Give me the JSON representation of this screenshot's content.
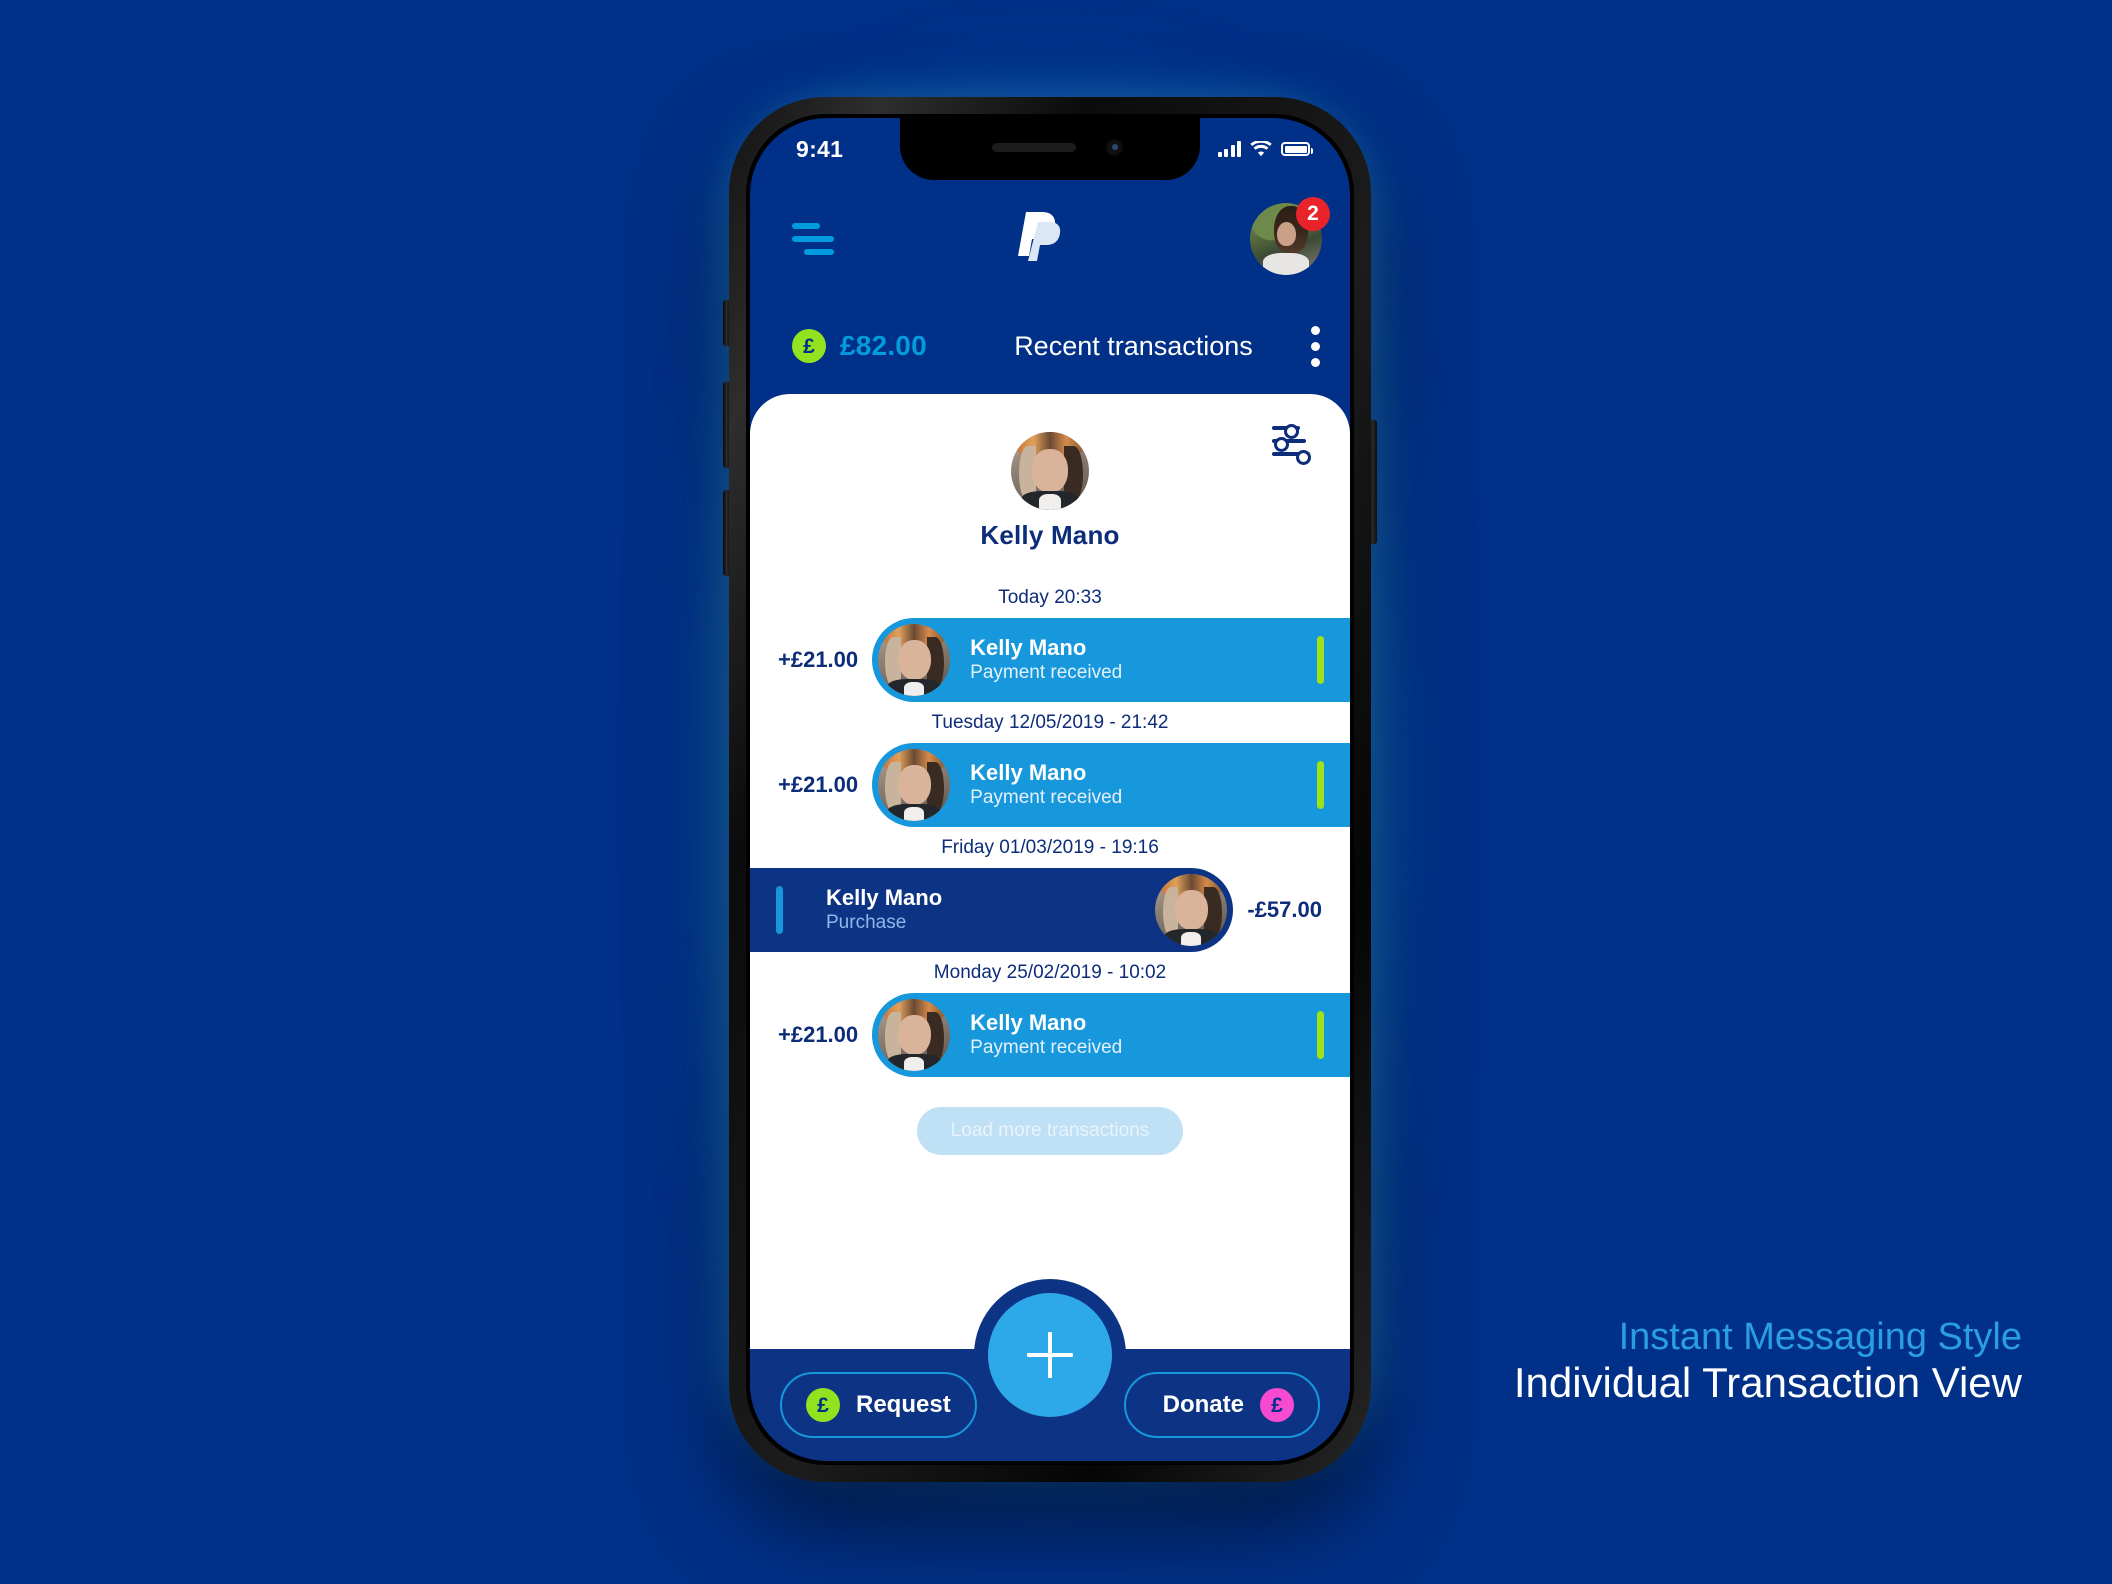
{
  "status_bar": {
    "time": "9:41",
    "signal_icon": "cellular-signal-icon",
    "wifi_icon": "wifi-icon",
    "battery_icon": "battery-icon"
  },
  "header": {
    "menu_icon": "hamburger-menu-icon",
    "logo": "paypal-logo",
    "avatar": "user-avatar",
    "notification_count": "2"
  },
  "balance_strip": {
    "currency_symbol": "£",
    "balance": "£82.00",
    "title": "Recent transactions",
    "overflow_icon": "kebab-menu-icon"
  },
  "card": {
    "filter_icon": "filter-sliders-icon",
    "contact_name": "Kelly Mano",
    "contact_avatar": "contact-avatar",
    "transactions": [
      {
        "date": "Today 20:33",
        "direction": "incoming",
        "amount": "+£21.00",
        "name": "Kelly Mano",
        "subtitle": "Payment received"
      },
      {
        "date": "Tuesday 12/05/2019 - 21:42",
        "direction": "incoming",
        "amount": "+£21.00",
        "name": "Kelly Mano",
        "subtitle": "Payment received"
      },
      {
        "date": "Friday 01/03/2019 - 19:16",
        "direction": "outgoing",
        "amount": "-£57.00",
        "name": "Kelly Mano",
        "subtitle": "Purchase"
      },
      {
        "date": "Monday 25/02/2019 - 10:02",
        "direction": "incoming",
        "amount": "+£21.00",
        "name": "Kelly Mano",
        "subtitle": "Payment received"
      }
    ],
    "load_more_label": "Load more transactions"
  },
  "bottom_bar": {
    "request_label": "Request",
    "request_icon": "pound-coin-green-icon",
    "donate_label": "Donate",
    "donate_icon": "pound-coin-pink-icon",
    "fab_icon": "plus-icon",
    "coin_glyph": "£"
  },
  "caption": {
    "line1": "Instant Messaging Style",
    "line2": "Individual Transaction View"
  },
  "colors": {
    "background": "#003087",
    "accent_blue": "#009cde",
    "bubble_in": "#1797dc",
    "bubble_out": "#0d3384",
    "green": "#92e220",
    "pink": "#f64ad0",
    "badge_red": "#e8232a",
    "deep_navy": "#0d2c7a"
  }
}
